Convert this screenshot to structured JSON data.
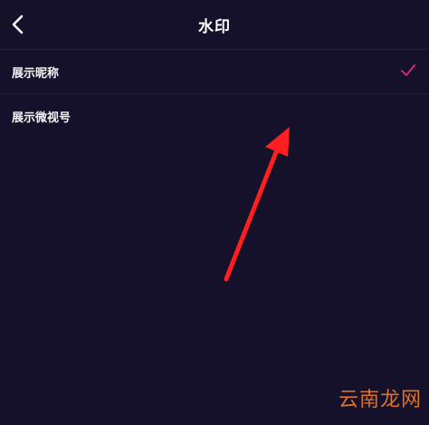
{
  "header": {
    "title": "水印",
    "back_icon": "chevron-left-icon"
  },
  "list": {
    "items": [
      {
        "label": "展示昵称",
        "checked": true,
        "check_icon": "checkmark-icon",
        "check_color": "#e0287a"
      },
      {
        "label": "展示微视号",
        "checked": false
      }
    ]
  },
  "annotation": {
    "arrow_color": "#ff1f1f"
  },
  "watermark": {
    "text": "云南龙网",
    "color": "#e8782a"
  },
  "colors": {
    "background": "#16112b",
    "divider": "#252040"
  }
}
